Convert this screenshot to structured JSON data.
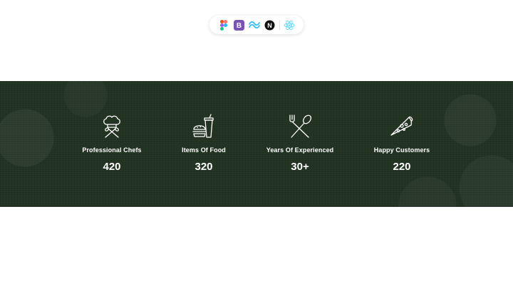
{
  "tech_stack": {
    "icons": [
      "figma-icon",
      "bootstrap-icon",
      "tailwind-icon",
      "nextjs-icon",
      "react-icon"
    ],
    "bootstrap_letter": "B",
    "nextjs_letter": "N"
  },
  "colors": {
    "band_background": "#223322",
    "stat_text": "#ffffff",
    "bootstrap": "#7952b3",
    "tailwind": "#38bdf8",
    "react": "#61dafb"
  },
  "stats": [
    {
      "icon": "chef-hat-icon",
      "label": "Professional Chefs",
      "value": "420"
    },
    {
      "icon": "fast-food-icon",
      "label": "Items Of Food",
      "value": "320"
    },
    {
      "icon": "fork-spoon-icon",
      "label": "Years Of Experienced",
      "value": "30+"
    },
    {
      "icon": "pizza-slice-icon",
      "label": "Happy Customers",
      "value": "220"
    }
  ]
}
